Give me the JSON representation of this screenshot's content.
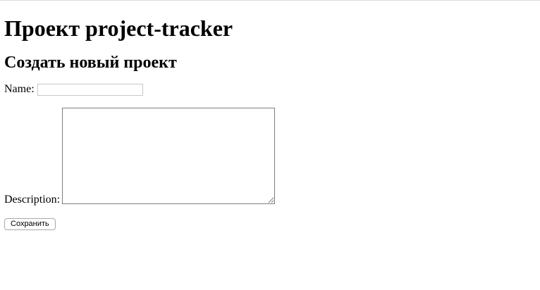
{
  "page": {
    "title": "Проект project-tracker",
    "subtitle": "Создать новый проект"
  },
  "form": {
    "name_label": "Name:",
    "name_value": "",
    "description_label": "Description:",
    "description_value": "",
    "submit_label": "Сохранить"
  }
}
